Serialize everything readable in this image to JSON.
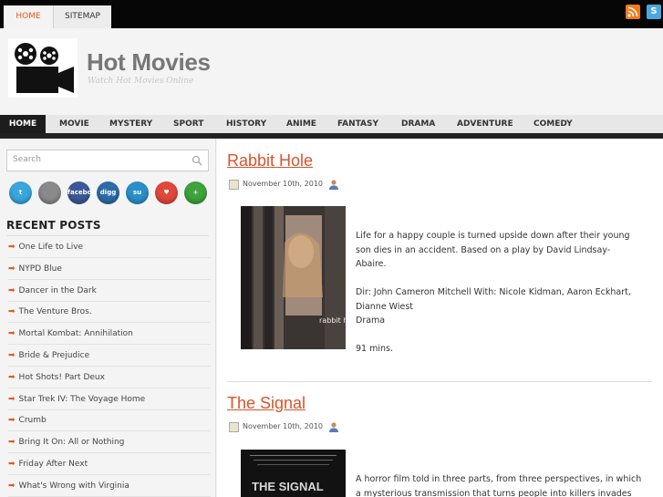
{
  "topbar": {
    "tabs": [
      {
        "label": "HOME"
      },
      {
        "label": "SITEMAP"
      }
    ]
  },
  "header": {
    "title": "Hot Movies",
    "tagline": "Watch Hot Movies Online"
  },
  "nav": {
    "items": [
      {
        "label": "HOME",
        "active": true
      },
      {
        "label": "MOVIE"
      },
      {
        "label": "MYSTERY"
      },
      {
        "label": "SPORT"
      },
      {
        "label": "HISTORY"
      },
      {
        "label": "ANIME"
      },
      {
        "label": "FANTASY"
      },
      {
        "label": "DRAMA"
      },
      {
        "label": "ADVENTURE"
      },
      {
        "label": "COMEDY"
      }
    ]
  },
  "sidebar": {
    "search_placeholder": "Search",
    "social": [
      {
        "name": "twitter",
        "label": "t",
        "color": "#3aa6dd"
      },
      {
        "name": "delicious",
        "label": "",
        "color": "#8a8a8a"
      },
      {
        "name": "facebook",
        "label": "facebook",
        "color": "#3b5998"
      },
      {
        "name": "digg",
        "label": "digg",
        "color": "#2d6ba8"
      },
      {
        "name": "stumbleupon",
        "label": "su",
        "color": "#2a8fc9"
      },
      {
        "name": "favorite",
        "label": "♥",
        "color": "#e0483c"
      },
      {
        "name": "add",
        "label": "+",
        "color": "#3ea33a"
      }
    ],
    "recent_title": "RECENT POSTS",
    "recent_posts": [
      "One Life to Live",
      "NYPD Blue",
      "Dancer in the Dark",
      "The Venture Bros.",
      "Mortal Kombat: Annihilation",
      "Bride & Prejudice",
      "Hot Shots! Part Deux",
      "Star Trek IV: The Voyage Home",
      "Crumb",
      "Bring It On: All or Nothing",
      "Friday After Next",
      "What's Wrong with Virginia"
    ]
  },
  "posts": [
    {
      "title": "Rabbit Hole",
      "date": "November 10th, 2010",
      "lines": [
        "Life for a happy couple is turned upside down after their young",
        "son dies in an accident. Based on a play by David Lindsay-",
        "Abaire.",
        "",
        "Dir: John Cameron Mitchell With: Nicole Kidman, Aaron Eckhart,",
        "Dianne Wiest",
        "Drama",
        "",
        "91 mins."
      ],
      "poster_text": "rabbit hole"
    },
    {
      "title": "The Signal",
      "date": "November 10th, 2010",
      "lines": [
        "A horror film told in three parts, from three perspectives, in which",
        "a mysterious transmission that turns people into killers invades"
      ],
      "poster_text": "THE SIGNAL"
    }
  ],
  "colors": {
    "accent": "#d9532a",
    "topbar": "#060606",
    "nav_active": "#1d1d1d"
  }
}
